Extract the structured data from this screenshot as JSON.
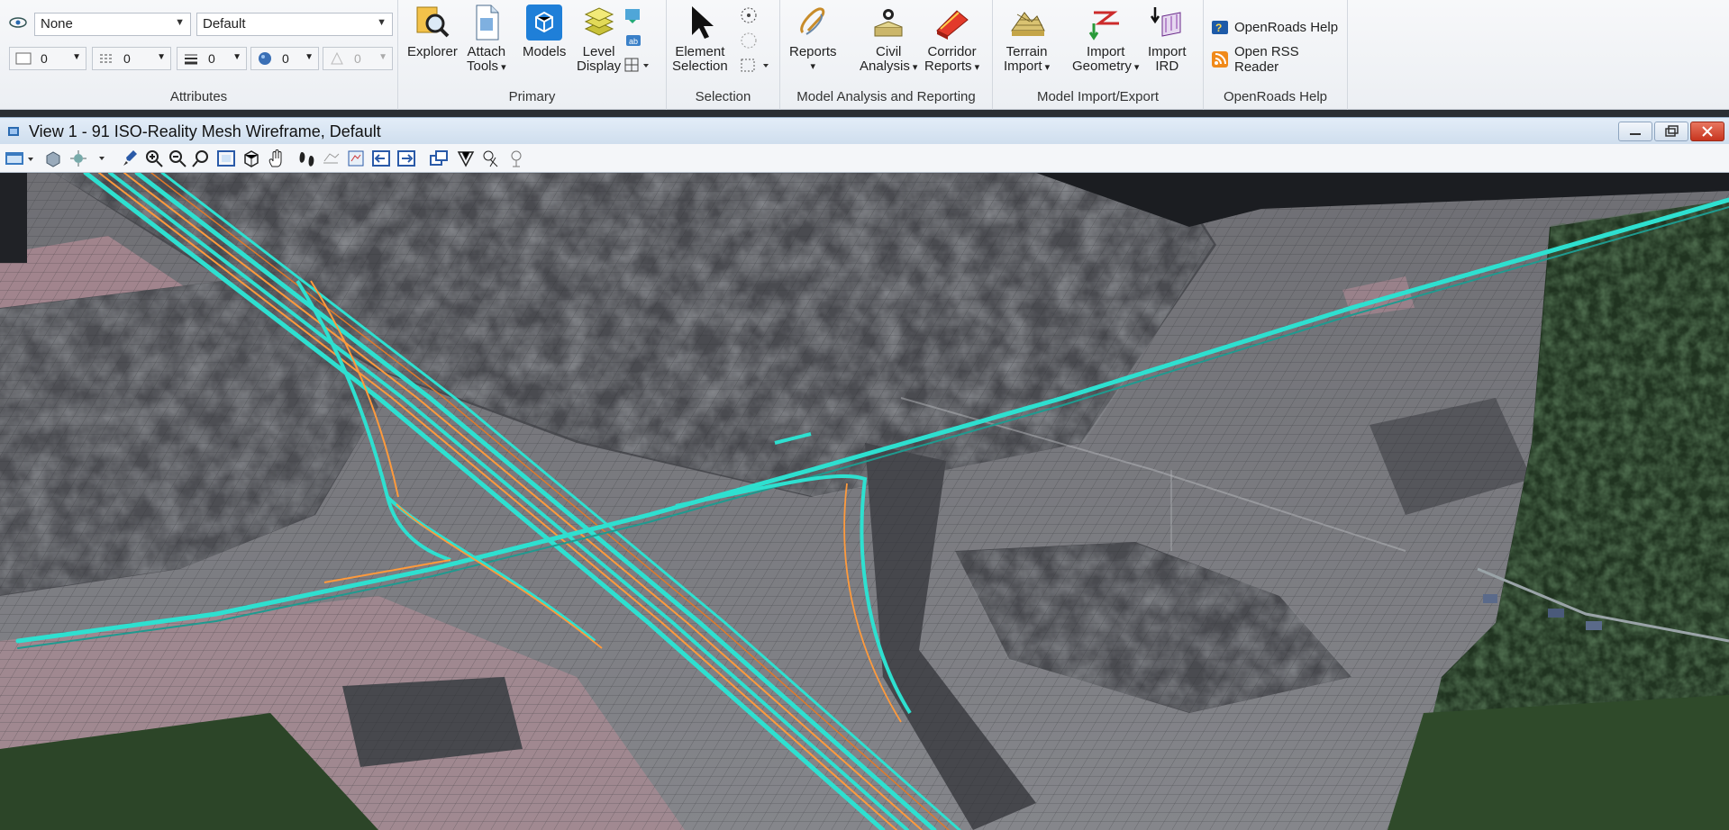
{
  "attributes": {
    "level_value": "None",
    "style_value": "Default",
    "color_value": "0",
    "linestyle_value": "0",
    "weight_value": "0",
    "class_value": "0",
    "transparency_value": "0",
    "label": "Attributes"
  },
  "primary": {
    "label": "Primary",
    "explorer": "Explorer",
    "attach_tools_line1": "Attach",
    "attach_tools_line2": "Tools",
    "models": "Models",
    "level_display_line1": "Level",
    "level_display_line2": "Display"
  },
  "selection": {
    "label": "Selection",
    "element_selection_line1": "Element",
    "element_selection_line2": "Selection"
  },
  "analysis": {
    "label": "Model Analysis and Reporting",
    "reports": "Reports",
    "civil_analysis_line1": "Civil",
    "civil_analysis_line2": "Analysis",
    "corridor_reports_line1": "Corridor",
    "corridor_reports_line2": "Reports"
  },
  "import_export": {
    "label": "Model Import/Export",
    "terrain_import_line1": "Terrain",
    "terrain_import_line2": "Import",
    "import_geometry_line1": "Import",
    "import_geometry_line2": "Geometry",
    "import_ird_line1": "Import",
    "import_ird_line2": "IRD"
  },
  "help": {
    "label": "OpenRoads Help",
    "openroads_help": "OpenRoads Help",
    "open_rss_reader": "Open RSS Reader"
  },
  "view": {
    "title": "View 1 - 91 ISO-Reality Mesh Wireframe, Default"
  },
  "colors": {
    "road_cyan": "#2ee0d0",
    "road_orange": "#ff9a3c",
    "mesh": "#5a5d63",
    "forest": "#1d2a1c"
  }
}
